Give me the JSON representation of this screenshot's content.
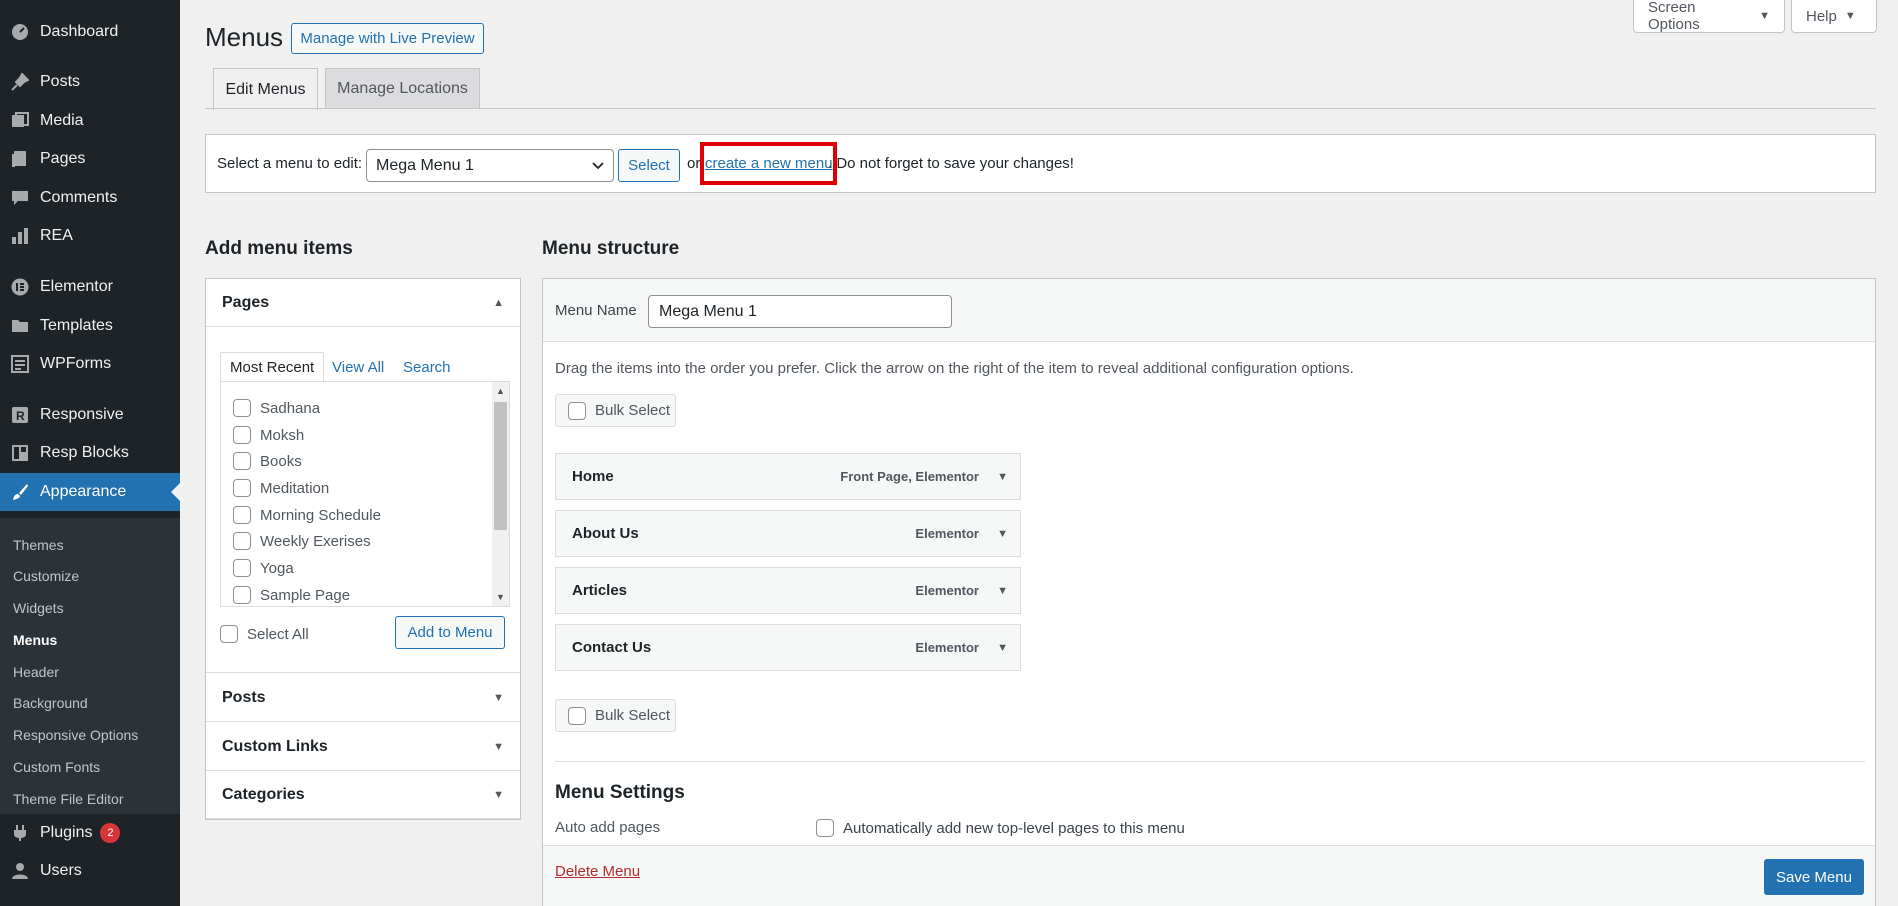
{
  "sidebar": {
    "items": [
      {
        "label": "Dashboard",
        "icon": "dashboard-icon"
      },
      {
        "label": "Posts",
        "icon": "pin-icon"
      },
      {
        "label": "Media",
        "icon": "media-icon"
      },
      {
        "label": "Pages",
        "icon": "pages-icon"
      },
      {
        "label": "Comments",
        "icon": "comment-icon"
      },
      {
        "label": "REA",
        "icon": "chart-icon"
      },
      {
        "label": "Elementor",
        "icon": "elementor-icon"
      },
      {
        "label": "Templates",
        "icon": "folder-icon"
      },
      {
        "label": "WPForms",
        "icon": "forms-icon"
      },
      {
        "label": "Responsive",
        "icon": "responsive-icon"
      },
      {
        "label": "Resp Blocks",
        "icon": "blocks-icon"
      },
      {
        "label": "Appearance",
        "icon": "brush-icon"
      },
      {
        "label": "Plugins",
        "icon": "plug-icon",
        "badge": "2"
      },
      {
        "label": "Users",
        "icon": "user-icon"
      }
    ],
    "submenu": [
      "Themes",
      "Customize",
      "Widgets",
      "Menus",
      "Header",
      "Background",
      "Responsive Options",
      "Custom Fonts",
      "Theme File Editor"
    ]
  },
  "top_buttons": {
    "screen_options": "Screen Options",
    "help": "Help"
  },
  "header": {
    "title": "Menus",
    "live_preview": "Manage with Live Preview"
  },
  "tabs": [
    {
      "label": "Edit Menus"
    },
    {
      "label": "Manage Locations"
    }
  ],
  "select_bar": {
    "label": "Select a menu to edit:",
    "selected": "Mega Menu 1",
    "select_button": "Select",
    "or_text": "or",
    "create_link": "create a new menu",
    "save_note": ". Do not forget to save your changes!"
  },
  "add_items": {
    "heading": "Add menu items",
    "pages_title": "Pages",
    "inner_tabs": [
      "Most Recent",
      "View All",
      "Search"
    ],
    "pages": [
      "Sadhana",
      "Moksh",
      "Books",
      "Meditation",
      "Morning Schedule",
      "Weekly Exerises",
      "Yoga",
      "Sample Page"
    ],
    "select_all": "Select All",
    "add_button": "Add to Menu",
    "other_sections": [
      "Posts",
      "Custom Links",
      "Categories"
    ]
  },
  "structure": {
    "heading": "Menu structure",
    "name_label": "Menu Name",
    "name_value": "Mega Menu 1",
    "help": "Drag the items into the order you prefer. Click the arrow on the right of the item to reveal additional configuration options.",
    "bulk_select": "Bulk Select",
    "items": [
      {
        "title": "Home",
        "type": "Front Page, Elementor"
      },
      {
        "title": "About Us",
        "type": "Elementor"
      },
      {
        "title": "Articles",
        "type": "Elementor"
      },
      {
        "title": "Contact Us",
        "type": "Elementor"
      }
    ],
    "settings_title": "Menu Settings",
    "auto_add_label": "Auto add pages",
    "auto_add_text": "Automatically add new top-level pages to this menu",
    "delete": "Delete Menu",
    "save": "Save Menu"
  }
}
